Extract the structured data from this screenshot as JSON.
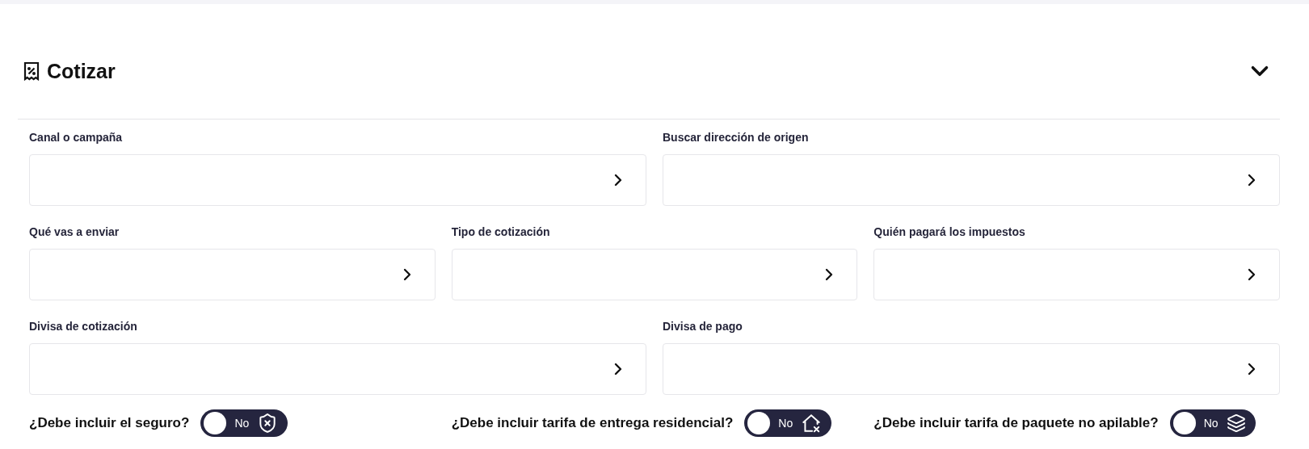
{
  "section": {
    "title": "Cotizar",
    "expanded": true
  },
  "field_rows": [
    [
      {
        "label": "Canal o campaña"
      },
      {
        "label": "Buscar dirección de origen"
      }
    ],
    [
      {
        "label": "Qué vas a enviar"
      },
      {
        "label": "Tipo de cotización"
      },
      {
        "label": "Quién pagará los impuestos"
      }
    ],
    [
      {
        "label": "Divisa de cotización"
      },
      {
        "label": "Divisa de pago"
      }
    ]
  ],
  "toggles": [
    {
      "question": "¿Debe incluir el seguro?",
      "value": "No",
      "on": false,
      "kind": "insurance"
    },
    {
      "question": "¿Debe incluir tarifa de entrega residencial?",
      "value": "No",
      "on": false,
      "kind": "residential"
    },
    {
      "question": "¿Debe incluir tarifa de paquete no apilable?",
      "value": "No",
      "on": false,
      "kind": "stackable"
    }
  ]
}
